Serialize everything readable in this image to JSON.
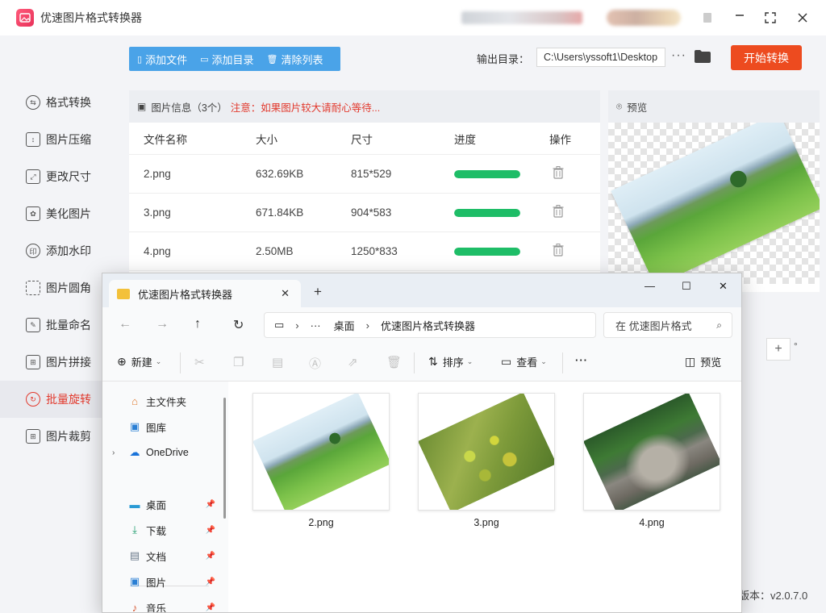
{
  "app": {
    "title": "优速图片格式转换器",
    "version": "版本：v2.0.7.0"
  },
  "sidebar": {
    "items": [
      {
        "label": "格式转换",
        "icon": "format-convert-icon"
      },
      {
        "label": "图片压缩",
        "icon": "compress-icon"
      },
      {
        "label": "更改尺寸",
        "icon": "resize-icon"
      },
      {
        "label": "美化图片",
        "icon": "beautify-icon"
      },
      {
        "label": "添加水印",
        "icon": "watermark-icon"
      },
      {
        "label": "图片圆角",
        "icon": "round-corner-icon"
      },
      {
        "label": "批量命名",
        "icon": "rename-icon"
      },
      {
        "label": "图片拼接",
        "icon": "stitch-icon"
      },
      {
        "label": "批量旋转",
        "icon": "rotate-icon",
        "active": true
      },
      {
        "label": "图片裁剪",
        "icon": "crop-icon"
      }
    ]
  },
  "toolbar": {
    "add_file": "添加文件",
    "add_folder": "添加目录",
    "clear_list": "清除列表",
    "output_label": "输出目录：",
    "output_path": "C:\\Users\\yssoft1\\Desktop",
    "start": "开始转换"
  },
  "list": {
    "header": "图片信息（3个）",
    "notice": "注意：如果图片较大请耐心等待...",
    "columns": [
      "文件名称",
      "大小",
      "尺寸",
      "进度",
      "操作"
    ],
    "rows": [
      {
        "name": "2.png",
        "size": "632.69KB",
        "dim": "815*529",
        "progress": 100
      },
      {
        "name": "3.png",
        "size": "671.84KB",
        "dim": "904*583",
        "progress": 100
      },
      {
        "name": "4.png",
        "size": "2.50MB",
        "dim": "1250*833",
        "progress": 100
      }
    ]
  },
  "preview": {
    "label": "预览",
    "degree_unit": "°"
  },
  "explorer": {
    "tab_title": "优速图片格式转换器",
    "breadcrumb": [
      "桌面",
      "优速图片格式转换器"
    ],
    "search_placeholder": "在 优速图片格式",
    "commands": {
      "new": "新建",
      "sort": "排序",
      "view": "查看",
      "preview": "预览"
    },
    "nav": [
      {
        "label": "主文件夹",
        "icon": "home-icon"
      },
      {
        "label": "图库",
        "icon": "gallery-icon"
      },
      {
        "label": "OneDrive",
        "icon": "onedrive-icon"
      },
      {
        "label": "桌面",
        "icon": "desktop-icon",
        "pinned": true
      },
      {
        "label": "下载",
        "icon": "download-icon",
        "pinned": true
      },
      {
        "label": "文档",
        "icon": "documents-icon",
        "pinned": true
      },
      {
        "label": "图片",
        "icon": "pictures-icon",
        "pinned": true
      },
      {
        "label": "音乐",
        "icon": "music-icon",
        "pinned": true
      }
    ],
    "files": [
      {
        "name": "2.png"
      },
      {
        "name": "3.png"
      },
      {
        "name": "4.png"
      }
    ]
  },
  "colors": {
    "accent_blue": "#4aa3e8",
    "start_orange": "#ed4b1f",
    "active_red": "#e23a2e",
    "progress_green": "#1ebd67"
  }
}
